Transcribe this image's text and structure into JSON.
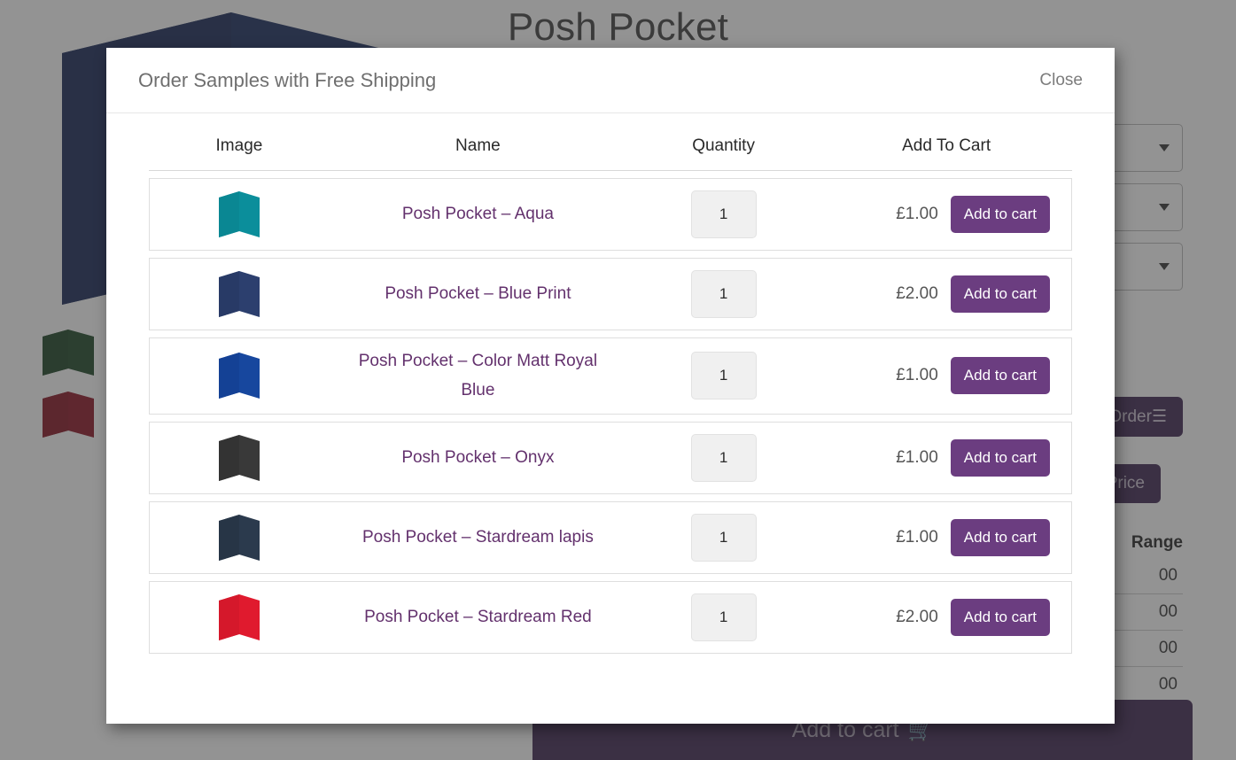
{
  "page": {
    "title": "Posh Pocket",
    "hero_color": "#16295c",
    "swatches": [
      {
        "name": "green-swatch",
        "color": "#1b4524"
      },
      {
        "name": "red-swatch",
        "color": "#8d1122"
      }
    ],
    "selects": [
      {
        "value": "",
        "caret": "chevron-down-icon"
      },
      {
        "value": "",
        "caret": "chevron-down-icon"
      },
      {
        "value": "",
        "caret": "chevron-down-icon"
      }
    ],
    "order_button_label": "Order",
    "order_button_icon": "list-icon",
    "price_button_label": "Price",
    "range_heading": "Range",
    "range_rows": [
      "00",
      "00",
      "00",
      "00"
    ],
    "add_to_cart_label": "Add to cart",
    "add_to_cart_icon": "shopping-cart-icon"
  },
  "modal": {
    "title": "Order Samples with Free Shipping",
    "close_label": "Close",
    "columns": [
      "Image",
      "Name",
      "Quantity",
      "Add To Cart"
    ],
    "rows": [
      {
        "thumb_color": "#0b8e9b",
        "thumb_name": "posh-pocket-aqua-thumbnail",
        "name": "Posh Pocket – Aqua",
        "quantity": "1",
        "price": "£1.00",
        "add_label": "Add to cart"
      },
      {
        "thumb_color": "#2c3f6e",
        "thumb_name": "posh-pocket-blue-print-thumbnail",
        "name": "Posh Pocket – Blue Print",
        "quantity": "1",
        "price": "£2.00",
        "add_label": "Add to cart"
      },
      {
        "thumb_color": "#17479e",
        "thumb_name": "posh-pocket-color-matt-royal-blue-thumbnail",
        "name": "Posh Pocket – Color Matt Royal Blue",
        "quantity": "1",
        "price": "£1.00",
        "add_label": "Add to cart"
      },
      {
        "thumb_color": "#393939",
        "thumb_name": "posh-pocket-onyx-thumbnail",
        "name": "Posh Pocket – Onyx",
        "quantity": "1",
        "price": "£1.00",
        "add_label": "Add to cart"
      },
      {
        "thumb_color": "#2b3a4d",
        "thumb_name": "posh-pocket-stardream-lapis-thumbnail",
        "name": "Posh Pocket – Stardream lapis",
        "quantity": "1",
        "price": "£1.00",
        "add_label": "Add to cart"
      },
      {
        "thumb_color": "#e01a2e",
        "thumb_name": "posh-pocket-stardream-red-thumbnail",
        "name": "Posh Pocket – Stardream Red",
        "quantity": "1",
        "price": "£2.00",
        "add_label": "Add to cart"
      }
    ]
  },
  "colors": {
    "accent_purple": "#6b3d80",
    "dark_purple": "#3d2450",
    "link_purple": "#63316d",
    "overlay": "#3b3b3b",
    "hero_navy": "#16295c"
  }
}
